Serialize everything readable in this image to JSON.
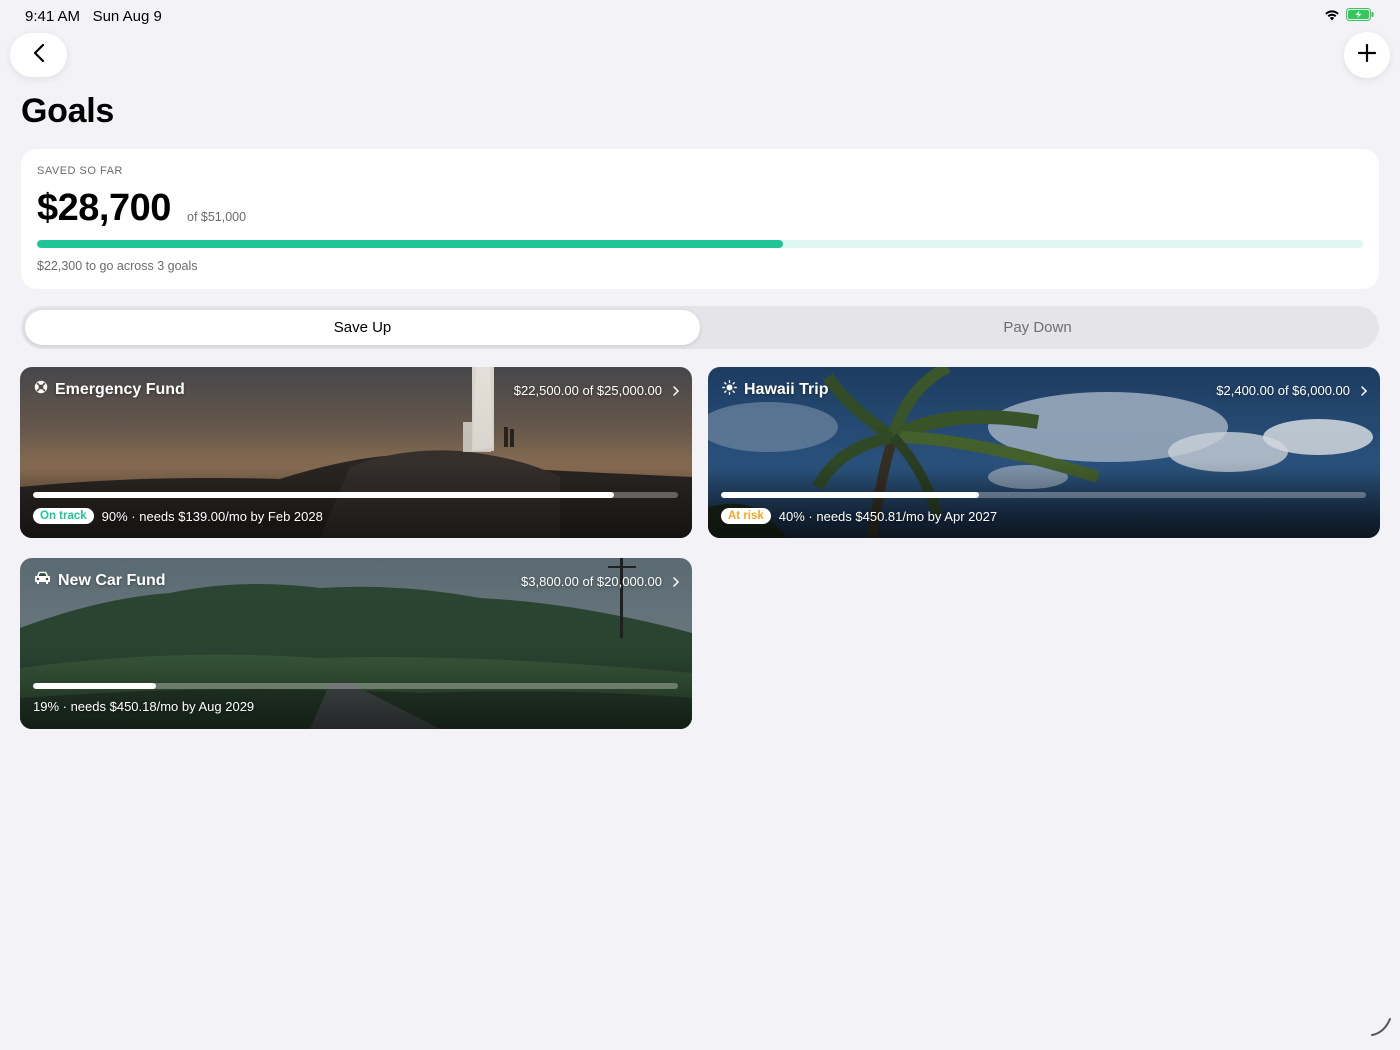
{
  "status": {
    "time": "9:41 AM",
    "date": "Sun Aug 9",
    "icons": [
      "wifi-icon",
      "battery-charging-icon"
    ]
  },
  "nav": {
    "back_icon": "chevron-left-icon",
    "add_icon": "plus-icon"
  },
  "page": {
    "title": "Goals"
  },
  "summary": {
    "label": "SAVED SO FAR",
    "amount": "$28,700",
    "of_text": "of $51,000",
    "progress": 0.5627,
    "footer": "$22,300 to go across 3 goals",
    "accent": "#1fc597"
  },
  "tabs": [
    {
      "label": "Save Up",
      "active": true
    },
    {
      "label": "Pay Down",
      "active": false
    }
  ],
  "goals": [
    {
      "title": "Emergency Fund",
      "icon": "lifebuoy-icon",
      "amount": "$22,500.00 of $25,000.00",
      "progress": 0.9,
      "badge": "On track",
      "badge_color": "#1fc597",
      "detail": "90% · needs $139.00/mo by Feb 2028"
    },
    {
      "title": "Hawaii Trip",
      "icon": "sun-icon",
      "amount": "$2,400.00 of $6,000.00",
      "progress": 0.4,
      "badge": "At risk",
      "badge_color": "#f5a623",
      "detail": "40% · needs $450.81/mo by Apr 2027"
    },
    {
      "title": "New Car Fund",
      "icon": "car-icon",
      "amount": "$3,800.00 of $20,000.00",
      "progress": 0.19,
      "badge": "",
      "detail": "19% · needs $450.18/mo by Aug 2029"
    }
  ]
}
